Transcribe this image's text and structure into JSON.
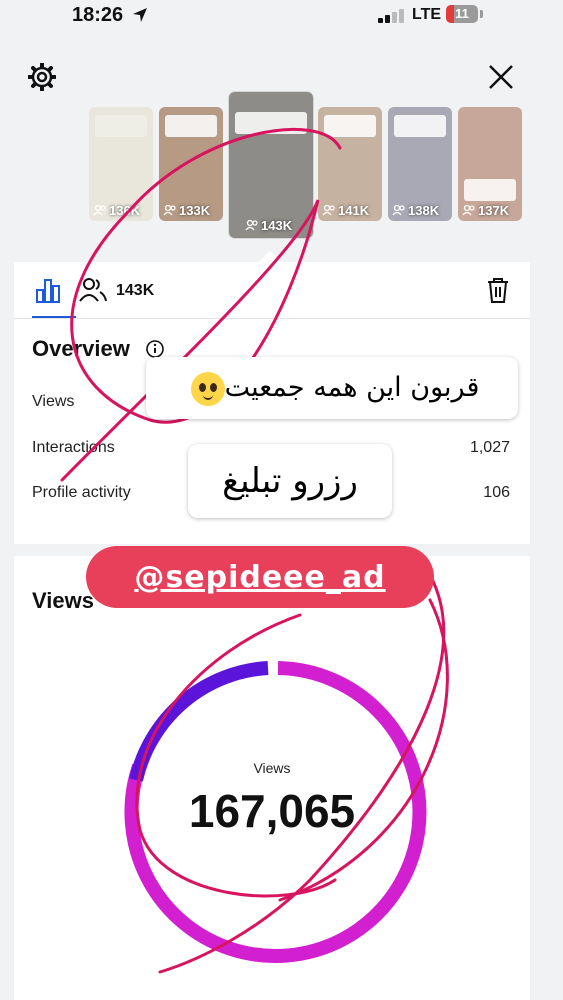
{
  "status_bar": {
    "time": "18:26",
    "network": "LTE",
    "battery": "11"
  },
  "header": {
    "settings_icon": "gear-icon",
    "close_icon": "close-icon"
  },
  "thumbnails": [
    {
      "count": "136K",
      "bg": "#e9e7dc",
      "selected": false
    },
    {
      "count": "133K",
      "bg": "#b79a84",
      "selected": false
    },
    {
      "count": "143K",
      "bg": "#8e8c88",
      "selected": true
    },
    {
      "count": "141K",
      "bg": "#c6b2a0",
      "selected": false
    },
    {
      "count": "138K",
      "bg": "#a8a9b5",
      "selected": false
    },
    {
      "count": "137K",
      "bg": "#c7a79a",
      "selected": false
    }
  ],
  "tabs": {
    "accounts_count": "143K"
  },
  "overview": {
    "title": "Overview",
    "rows": [
      {
        "label": "Views",
        "value": ""
      },
      {
        "label": "Interactions",
        "value": "1,027"
      },
      {
        "label": "Profile activity",
        "value": "106"
      }
    ]
  },
  "views_section": {
    "title": "Views",
    "donut_label": "Views",
    "total": "167,065"
  },
  "overlay": {
    "sticker1_text": "قربون این همه جمعیت",
    "sticker2_text": "رزرو تبلیغ",
    "handle_text": "@sepideee_ad"
  },
  "colors": {
    "accent_blue": "#1e5bd8",
    "donut_purple": "#5b14d9",
    "donut_magenta": "#d21fd0",
    "ink_pink": "#d8145e",
    "handle_bg": "#e8405b"
  }
}
